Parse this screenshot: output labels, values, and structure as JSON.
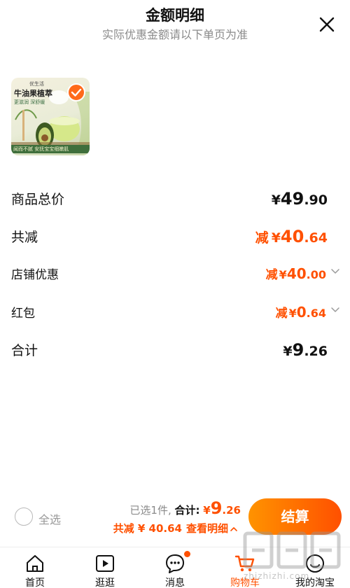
{
  "header": {
    "title": "金额明细",
    "subtitle": "实际优惠金额请以下单页为准"
  },
  "product": {
    "brand": "优生活",
    "name": "牛油果植萃",
    "tags": "更滋润 深舒缓",
    "banner": "闻而不腻 安抚宝宝细嫩肌"
  },
  "summary": {
    "total_price": {
      "label": "商品总价",
      "yen": "¥",
      "int": "49",
      "dec": ".90"
    },
    "total_reduce": {
      "label": "共减",
      "prefix": "减",
      "yen": "¥",
      "int": "40",
      "dec": ".64"
    },
    "shop_discount": {
      "label": "店铺优惠",
      "prefix": "减",
      "yen": "¥",
      "int": "40",
      "dec": ".00"
    },
    "red_packet": {
      "label": "红包",
      "prefix": "减",
      "yen": "¥",
      "int": "0",
      "dec": ".64"
    },
    "subtotal": {
      "label": "合计",
      "yen": "¥",
      "int": "9",
      "dec": ".26"
    }
  },
  "checkout": {
    "select_all": "全选",
    "selected_text": "已选1件,",
    "sum_label": "合计:",
    "sum_yen": "¥",
    "sum_int": "9",
    "sum_dec": ".26",
    "reduce_text": "共减 ¥ 40.64",
    "view_detail": "查看明细",
    "button": "结算"
  },
  "tabbar": {
    "items": [
      {
        "label": "首页",
        "icon": "home-icon"
      },
      {
        "label": "逛逛",
        "icon": "play-icon"
      },
      {
        "label": "消息",
        "icon": "message-icon"
      },
      {
        "label": "购物车",
        "icon": "cart-icon"
      },
      {
        "label": "我的淘宝",
        "icon": "profile-icon"
      }
    ],
    "active": "购物车"
  },
  "watermark": {
    "url": "zhizhizhi.com"
  },
  "colors": {
    "accent": "#ff5000",
    "button_start": "#ff9300",
    "button_end": "#ff5000",
    "muted": "#8a8a8a"
  }
}
